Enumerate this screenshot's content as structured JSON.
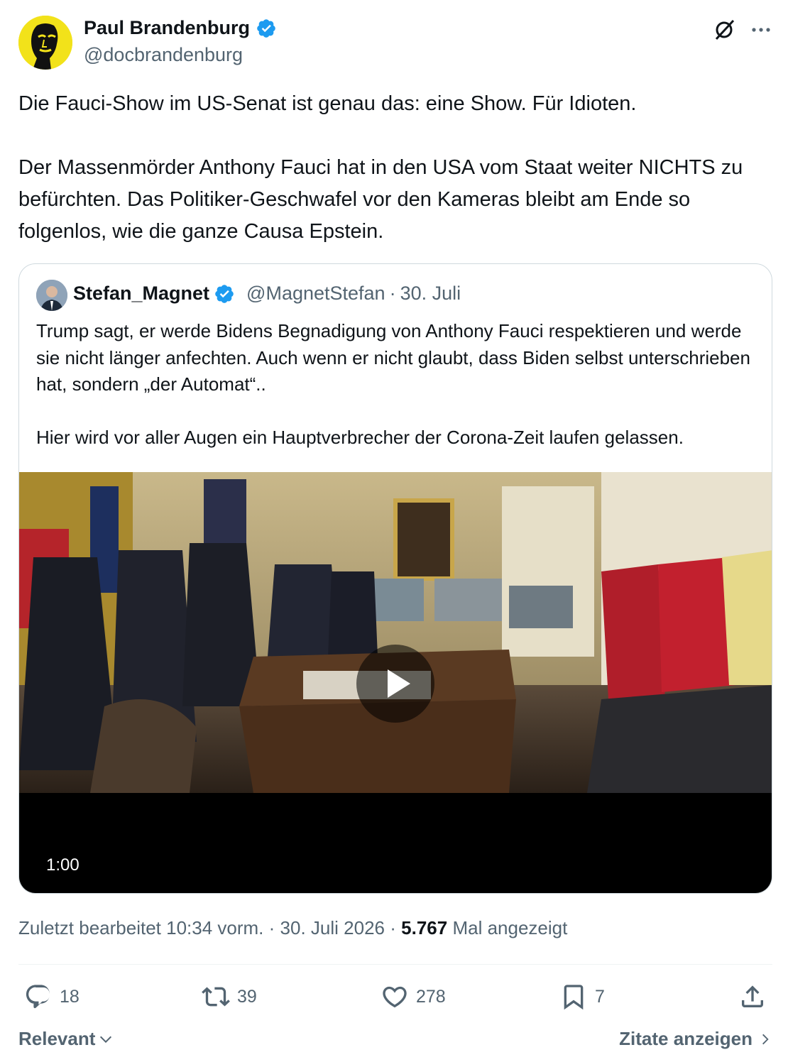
{
  "author": {
    "name": "Paul Brandenburg",
    "handle": "@docbrandenburg",
    "verified_icon": "verified-badge-icon",
    "avatar_color": "#f2e21a"
  },
  "header_actions": {
    "grok_icon": "grok-icon",
    "more_icon": "more-icon"
  },
  "tweet": {
    "paragraph1": "Die Fauci-Show im US-Senat ist genau das: eine Show. Für Idioten.",
    "paragraph2": "Der Massenmörder Anthony Fauci hat in den USA vom Staat weiter NICHTS zu befürchten. Das Politiker-Geschwafel vor den Kameras bleibt am Ende so folgenlos, wie die ganze Causa Epstein."
  },
  "quote": {
    "name": "Stefan_Magnet",
    "handle": "@MagnetStefan",
    "separator": "·",
    "date": "30. Juli",
    "paragraph1": "Trump sagt, er werde Bidens Begnadigung von Anthony Fauci respektieren und werde sie nicht länger anfechten. Auch wenn er nicht glaubt, dass Biden selbst unterschrieben hat, sondern „der Automat“..",
    "paragraph2": "Hier wird vor aller Augen ein Hauptverbrecher der Corona-Zeit laufen gelassen.",
    "video": {
      "duration": "1:00",
      "play_icon": "play-icon"
    }
  },
  "meta": {
    "edited": "Zuletzt bearbeitet 10:34 vorm.",
    "separator": "·",
    "date": "30. Juli 2026",
    "views_count": "5.767",
    "views_label": "Mal angezeigt"
  },
  "actions": {
    "replies": "18",
    "reposts": "39",
    "likes": "278",
    "bookmarks": "7"
  },
  "footer": {
    "sort_label": "Relevant",
    "quotes_label": "Zitate anzeigen"
  },
  "colors": {
    "text": "#0f1419",
    "secondary": "#536471",
    "verified": "#1d9bf0",
    "border": "#cfd9de"
  }
}
